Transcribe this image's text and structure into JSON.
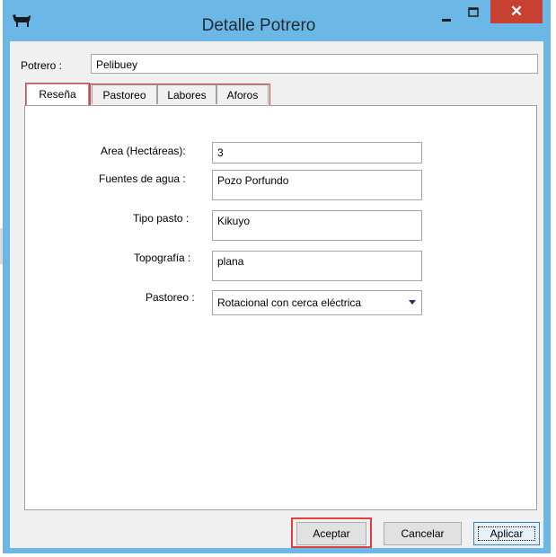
{
  "window": {
    "title": "Detalle Potrero",
    "close_glyph": "✕",
    "icons": {
      "app": "cattle-icon",
      "minimize": "minimize-icon",
      "maximize": "maximize-icon",
      "close": "close-icon"
    }
  },
  "potrero": {
    "label": "Potrero :",
    "value": "Pelibuey"
  },
  "tabs": [
    {
      "label": "Reseña"
    },
    {
      "label": "Pastoreo"
    },
    {
      "label": "Labores"
    },
    {
      "label": "Aforos"
    }
  ],
  "form": {
    "area": {
      "label": "Area (Hectáreas):",
      "value": "3"
    },
    "fuentes": {
      "label": "Fuentes de agua :",
      "value": "Pozo Porfundo"
    },
    "tipo_pasto": {
      "label": "Tipo pasto :",
      "value": "Kikuyo"
    },
    "topografia": {
      "label": "Topografía :",
      "value": "plana"
    },
    "pastoreo": {
      "label": "Pastoreo :",
      "value": "Rotacional con cerca eléctrica"
    }
  },
  "buttons": {
    "aceptar": "Aceptar",
    "cancelar": "Cancelar",
    "aplicar": "Aplicar"
  },
  "colors": {
    "titlebar": "#6bb7e6",
    "close": "#c84031",
    "highlight": "#e04040"
  }
}
